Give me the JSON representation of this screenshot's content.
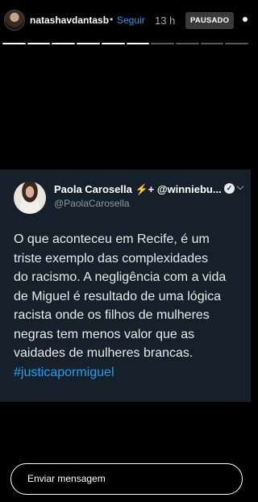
{
  "story": {
    "username": "natashavdantasb",
    "separator": "•",
    "follow_label": "Seguir",
    "time": "13 h",
    "paused_label": "PAUSADO",
    "progress_total": 10,
    "progress_completed": 6
  },
  "tweet": {
    "display_name": "Paola Carosella ⚡+ @winniebu...",
    "verified_symbol": "✓",
    "handle": "@PaolaCarosella",
    "lines": [
      "O que aconteceu em Recife, é um",
      "triste exemplo das complexidades",
      "do racismo. A negligência com a vida",
      "de Miguel é resultado de uma lógica",
      "racista onde os filhos de mulheres",
      "negras tem menos valor que as",
      "vaidades de mulheres brancas."
    ],
    "hashtag": "#justicapormiguel"
  },
  "reply": {
    "placeholder": "Enviar mensagem"
  },
  "colors": {
    "background": "#000000",
    "tweet_background": "#15202b",
    "link": "#3897f0",
    "hashtag": "#1da1f2"
  }
}
